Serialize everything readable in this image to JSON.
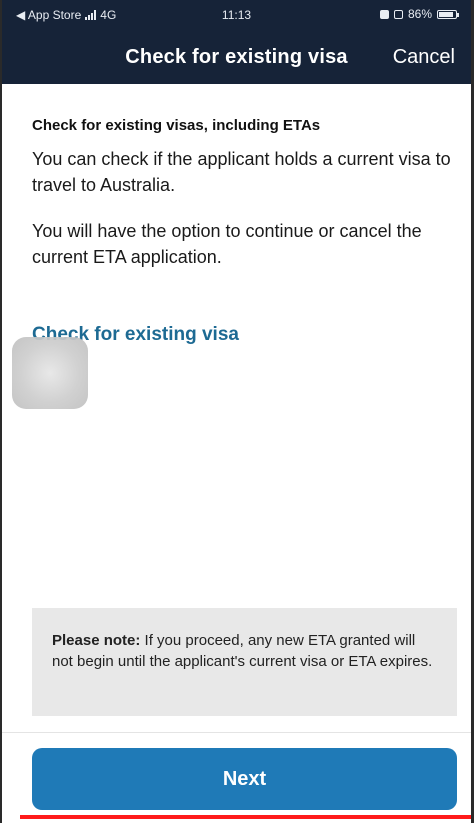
{
  "status_bar": {
    "back_label": "◀ App Store",
    "network": "4G",
    "time": "11:13",
    "battery_percent": "86%",
    "battery_level": 0.86
  },
  "nav": {
    "title": "Check for existing visa",
    "cancel_label": "Cancel"
  },
  "main": {
    "heading": "Check for existing visas, including ETAs",
    "paragraph_1": "You can check if the applicant holds a current visa to travel to Australia.",
    "paragraph_2": "You will have the option to continue or cancel the current ETA application.",
    "link_label": "Check for existing visa"
  },
  "note": {
    "label": "Please note:",
    "text": " If you proceed, any new ETA granted will not begin until the applicant's current visa or ETA expires."
  },
  "footer": {
    "next_label": "Next"
  },
  "colors": {
    "header_bg": "#162338",
    "link": "#1d6a93",
    "button": "#1f7ab7",
    "note_bg": "#e8e8e8"
  }
}
